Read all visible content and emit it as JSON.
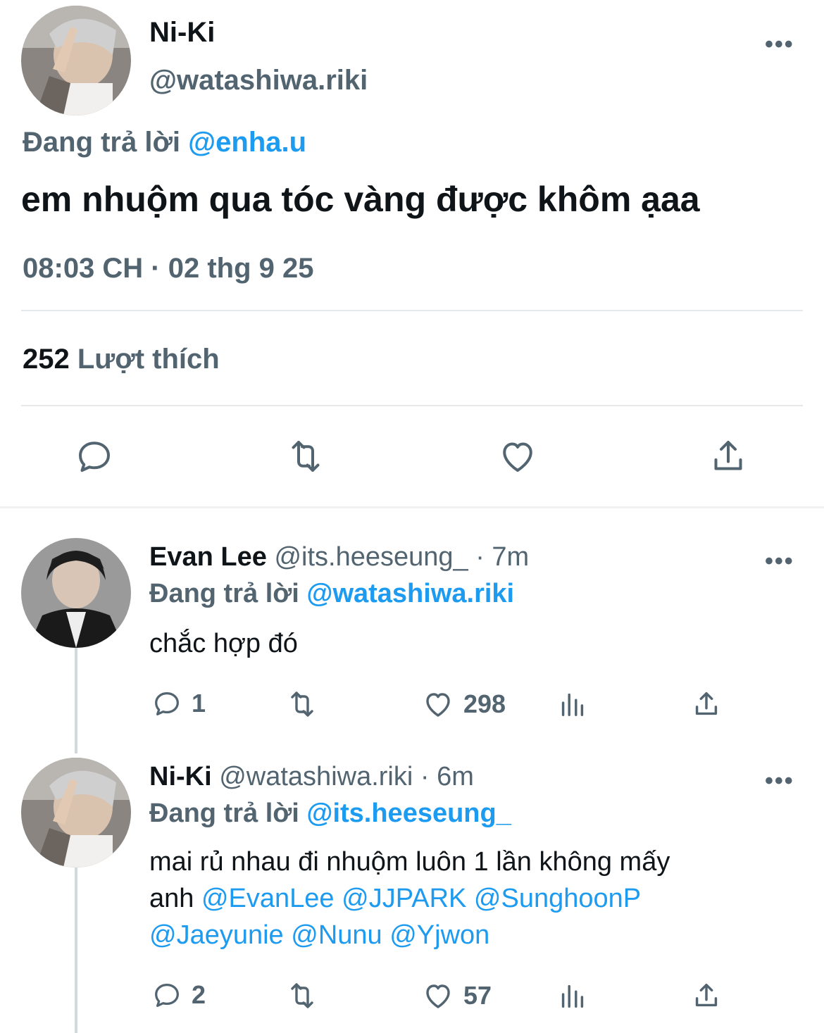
{
  "main_tweet": {
    "display_name": "Ni-Ki",
    "handle": "@watashiwa.riki",
    "replying_prefix": "Đang trả lời",
    "replying_to": "@enha.u",
    "text": "em nhuộm qua tóc vàng được khôm ạaa",
    "timestamp": "08:03 CH · 02 thg 9 25",
    "like_count": "252",
    "like_label": "Lượt thích",
    "more_label": "•••"
  },
  "replies": [
    {
      "display_name": "Evan Lee",
      "handle": "@its.heeseung_",
      "time": "· 7m",
      "replying_prefix": "Đang trả lời",
      "replying_to": "@watashiwa.riki",
      "text": "chắc hợp đó",
      "reply_count": "1",
      "like_count": "298",
      "more_label": "•••"
    },
    {
      "display_name": "Ni-Ki",
      "handle": "@watashiwa.riki",
      "time": "· 6m",
      "replying_prefix": "Đang trả lời",
      "replying_to": "@its.heeseung_",
      "text_line1": "mai rủ nhau đi nhuộm luôn 1 lần không mấy",
      "text_line2_prefix": "anh",
      "mentions": [
        "@EvanLee",
        "@JJPARK",
        "@SunghoonP",
        "@Jaeyunie",
        "@Nunu",
        "@Yjwon"
      ],
      "reply_count": "2",
      "like_count": "57",
      "more_label": "•••"
    }
  ],
  "icons": {
    "reply": "comment-icon",
    "retweet": "retweet-icon",
    "like": "heart-icon",
    "share": "share-icon",
    "views": "views-icon"
  },
  "colors": {
    "accent": "#1d9bf0",
    "muted": "#536471",
    "text": "#0f1419",
    "divider": "#e6e9eb"
  }
}
